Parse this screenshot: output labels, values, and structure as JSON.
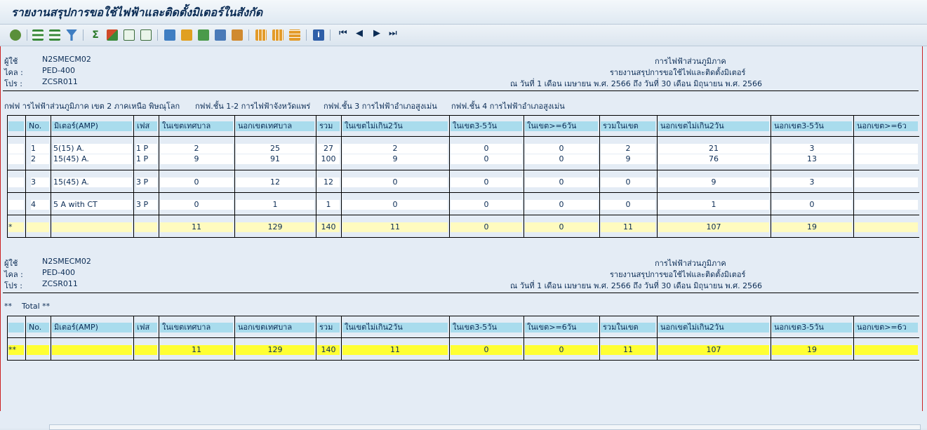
{
  "title": "รายงานสรุปการขอใช้ไฟฟ้าและติดตั้งมิเตอร์ในสังกัด",
  "header_block": {
    "user_label": "ผู้ใช้",
    "user_value": "N2SMECM02",
    "file_label": "ไคล :",
    "file_value": "PED-400",
    "prog_label": "โปร :",
    "prog_value": "ZCSR011",
    "org": "การไฟฟ้าส่วนภูมิภาค",
    "report_name": "รายงานสรุปการขอใช้ไฟและติดตั้งมิเตอร์",
    "period": "ณ วันที่ 1 เดือน เมษายน พ.ศ. 2566 ถึง วันที่ 30 เดือน มิถุนายน พ.ศ. 2566"
  },
  "filter_line": {
    "a": "กฟฟ  ารไฟฟ้าส่วนภูมิภาค เขต 2 ภาคเหนือ พิษณุโลก",
    "b": "กฟฟ.ชั้น 1-2 การไฟฟ้าจังหวัดแพร่",
    "c": "กฟฟ.ชั้น 3 การไฟฟ้าอำเภอสูงเม่น",
    "d": "กฟฟ.ชั้น 4 การไฟฟ้าอำเภอสูงเม่น"
  },
  "columns": [
    "",
    "No.",
    "มิเตอร์(AMP)",
    "เฟส",
    "ในเขตเทศบาล",
    "นอกเขตเทศบาล",
    "รวม",
    "ในเขตไม่เกิน2วัน",
    "ในเขต3-5วัน",
    "ในเขต>=6วัน",
    "รวมในเขต",
    "นอกเขตไม่เกิน2วัน",
    "นอกเขต3-5วัน",
    "นอกเขต>=6ว"
  ],
  "rows": [
    {
      "no": "1",
      "meter": "5(15) A.",
      "phase": "1 P",
      "v": [
        "2",
        "25",
        "27",
        "2",
        "0",
        "0",
        "2",
        "21",
        "3",
        ""
      ]
    },
    {
      "no": "2",
      "meter": "15(45) A.",
      "phase": "1 P",
      "v": [
        "9",
        "91",
        "100",
        "9",
        "0",
        "0",
        "9",
        "76",
        "13",
        ""
      ]
    },
    {
      "no": "3",
      "meter": "15(45) A.",
      "phase": "3 P",
      "v": [
        "0",
        "12",
        "12",
        "0",
        "0",
        "0",
        "0",
        "9",
        "3",
        ""
      ]
    },
    {
      "no": "4",
      "meter": "5 A with CT",
      "phase": "3 P",
      "v": [
        "0",
        "1",
        "1",
        "0",
        "0",
        "0",
        "0",
        "1",
        "0",
        ""
      ]
    }
  ],
  "subtotal": {
    "mark": "*",
    "v": [
      "11",
      "129",
      "140",
      "11",
      "0",
      "0",
      "11",
      "107",
      "19",
      ""
    ]
  },
  "total_label": "**    Total **",
  "grand_total": {
    "mark": "**",
    "v": [
      "11",
      "129",
      "140",
      "11",
      "0",
      "0",
      "11",
      "107",
      "19",
      ""
    ]
  },
  "icons": [
    "refresh-icon",
    "sort-asc-icon",
    "sort-desc-icon",
    "filter-icon",
    "sum-icon",
    "subtotal-icon",
    "expand-icon",
    "collapse-icon",
    "export-icon",
    "layout-icon",
    "spreadsheet-icon",
    "word-icon",
    "send-icon",
    "grid-icon",
    "columns-icon",
    "rows-icon",
    "info-icon",
    "first-page-icon",
    "prev-page-icon",
    "next-page-icon",
    "last-page-icon"
  ]
}
